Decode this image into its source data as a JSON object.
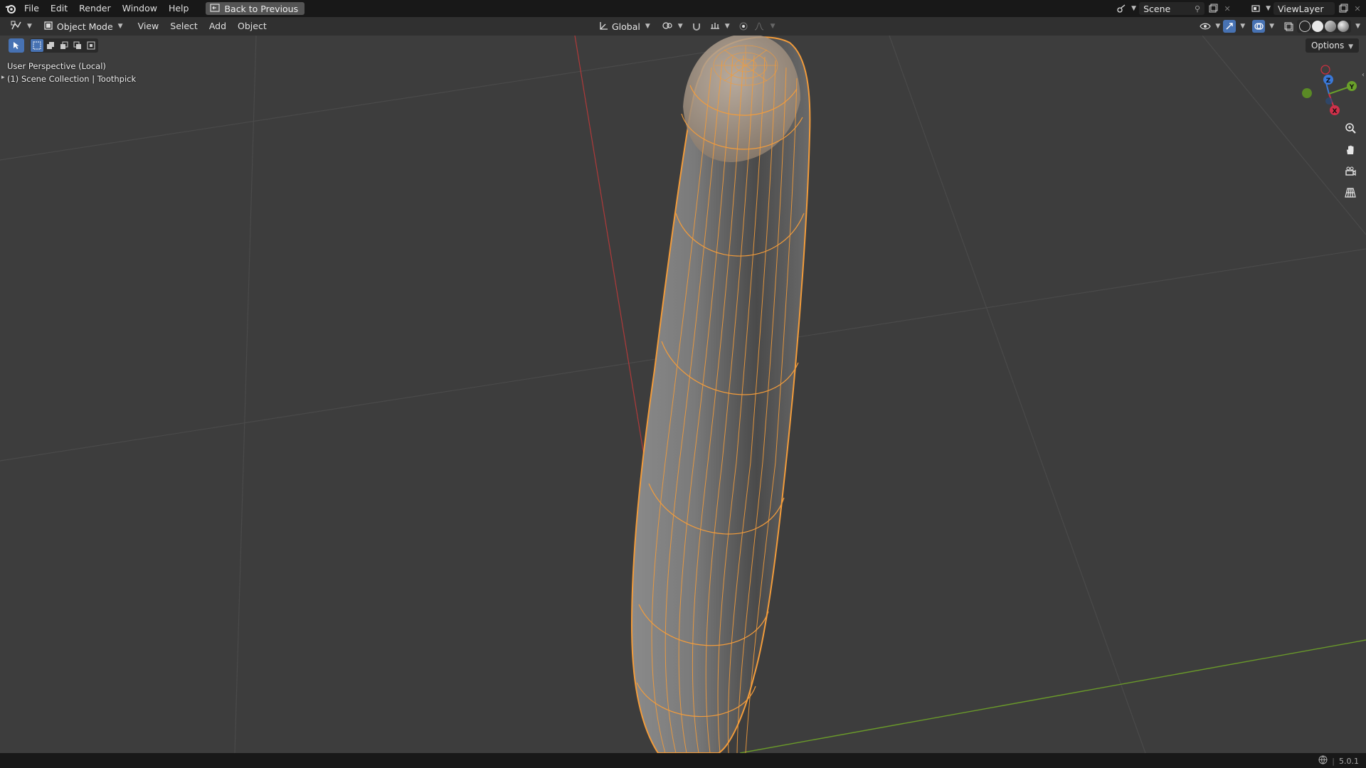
{
  "menubar": {
    "items": [
      "File",
      "Edit",
      "Render",
      "Window",
      "Help"
    ],
    "back_button": "Back to Previous",
    "scene_name": "Scene",
    "view_layer": "ViewLayer"
  },
  "header": {
    "mode": "Object Mode",
    "menus": [
      "View",
      "Select",
      "Add",
      "Object"
    ],
    "orientation": "Global",
    "options": "Options"
  },
  "viewport": {
    "view_name": "User Perspective (Local)",
    "collection": "(1) Scene Collection | Toothpick",
    "axes": {
      "x": "X",
      "y": "Y",
      "z": "Z"
    },
    "selection_color": "#f39c3b",
    "x_axis_color": "#b03a3a",
    "y_axis_color": "#6a9a2a"
  },
  "statusbar": {
    "version": "5.0.1"
  }
}
